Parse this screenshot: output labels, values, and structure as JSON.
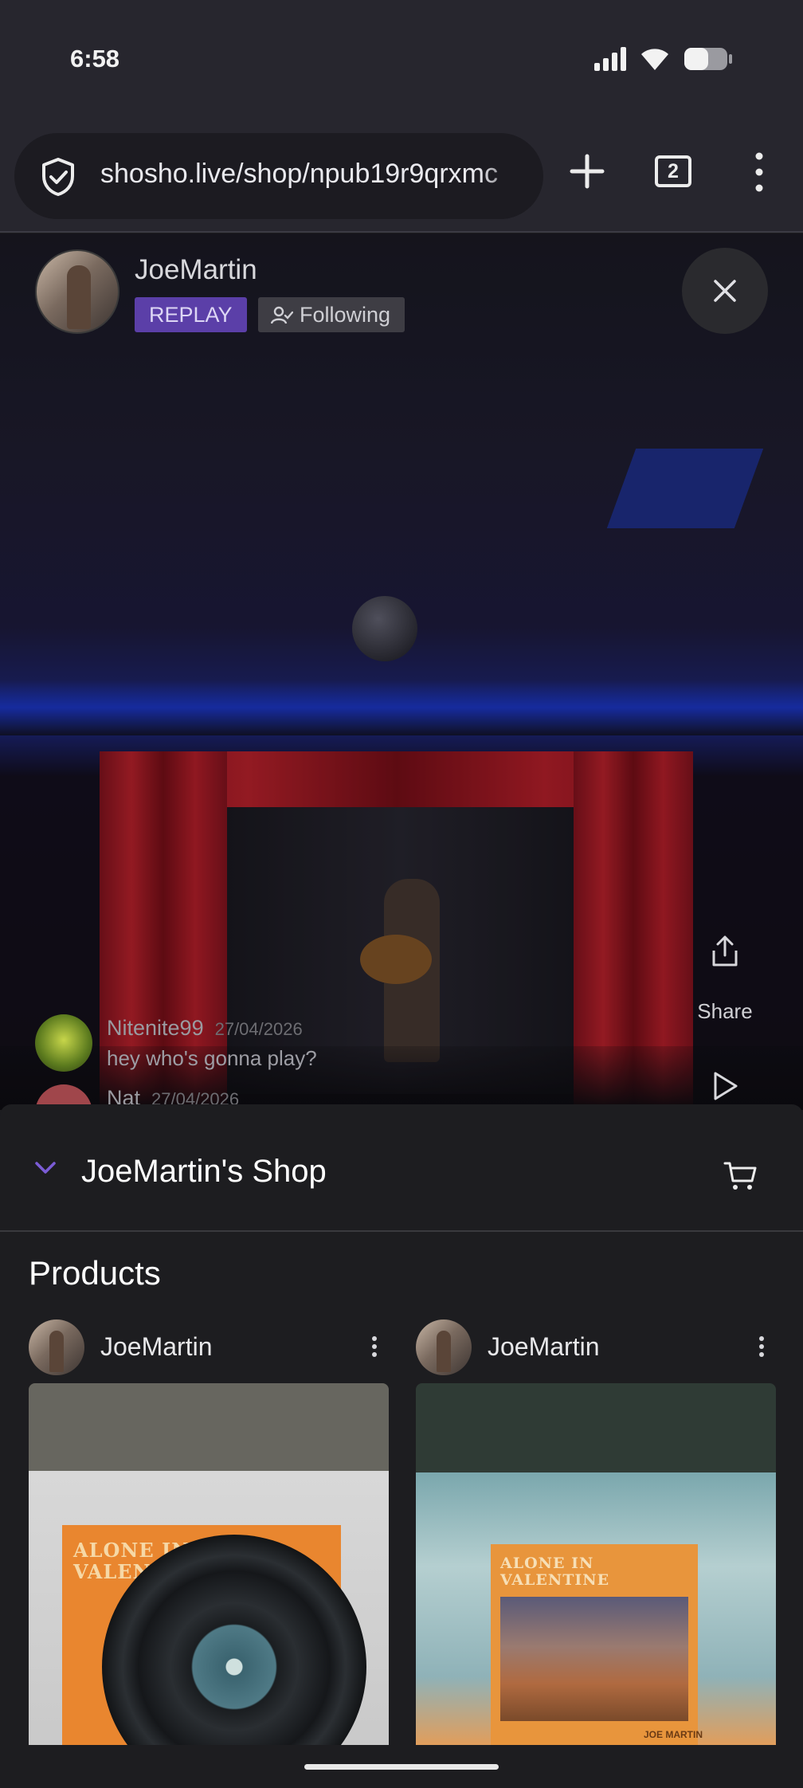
{
  "status_bar": {
    "time": "6:58"
  },
  "browser": {
    "url": "shosho.live/shop/npub19r9qrxmc",
    "tab_count": "2"
  },
  "stream": {
    "streamer_name": "JoeMartin",
    "replay_badge": "REPLAY",
    "following_label": "Following",
    "share_label": "Share",
    "chat": [
      {
        "user": "Nitenite99",
        "date": "27/04/2026",
        "message": "hey who's gonna play?"
      },
      {
        "user": "Nat",
        "date": "27/04/2026",
        "message": ""
      }
    ]
  },
  "shop": {
    "title": "JoeMartin's Shop",
    "products_heading": "Products",
    "products": [
      {
        "seller": "JoeMartin",
        "cover_title": "ALONE IN\nVALENTINE"
      },
      {
        "seller": "JoeMartin",
        "cover_title": "ALONE IN\nVALENTINE",
        "artist": "JOE MARTIN"
      }
    ]
  },
  "colors": {
    "replay_badge": "#5b3fa8",
    "accent_chevron": "#7b5cd6",
    "panel_bg": "#1d1d20"
  }
}
